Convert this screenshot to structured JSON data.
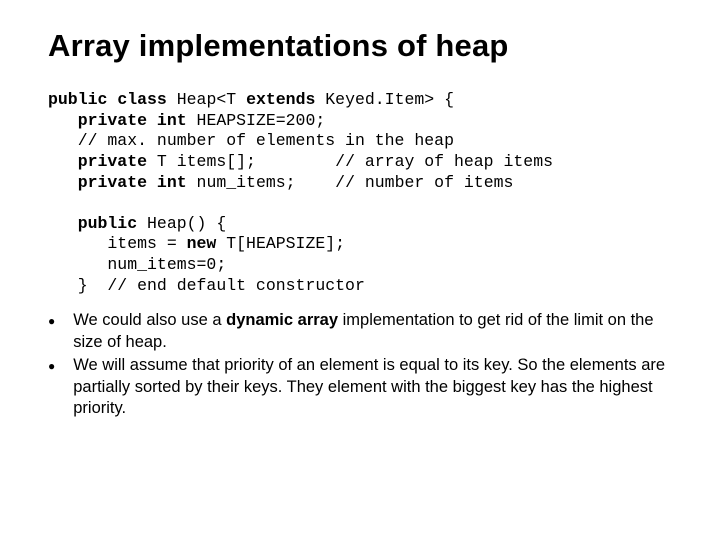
{
  "title": "Array implementations of heap",
  "code": {
    "l1a": "public",
    "l1b": " class",
    "l1c": " Heap<T ",
    "l1d": "extends",
    "l1e": " Keyed.Item> {",
    "l2a": "   private",
    "l2b": " int",
    "l2c": " HEAPSIZE=200;",
    "l3": "   // max. number of elements in the heap",
    "l4a": "   private",
    "l4b": " T items[];        // array of heap items",
    "l5a": "   private",
    "l5b": " int",
    "l5c": " num_items;    // number of items",
    "blank1": "",
    "l6a": "   public",
    "l6b": " Heap() {",
    "l7a": "      items = ",
    "l7b": "new",
    "l7c": " T[HEAPSIZE];",
    "l8": "      num_items=0;",
    "l9": "   }  // end default constructor",
    "blank2": ""
  },
  "bullets": [
    {
      "pre": "We could also use a ",
      "bold": "dynamic array",
      "post": " implementation to get rid of the limit on the size of heap."
    },
    {
      "pre": "We will assume that priority of an element is equal to its key. So the elements are partially sorted by their keys. They element with the biggest key has the highest priority.",
      "bold": "",
      "post": ""
    }
  ]
}
